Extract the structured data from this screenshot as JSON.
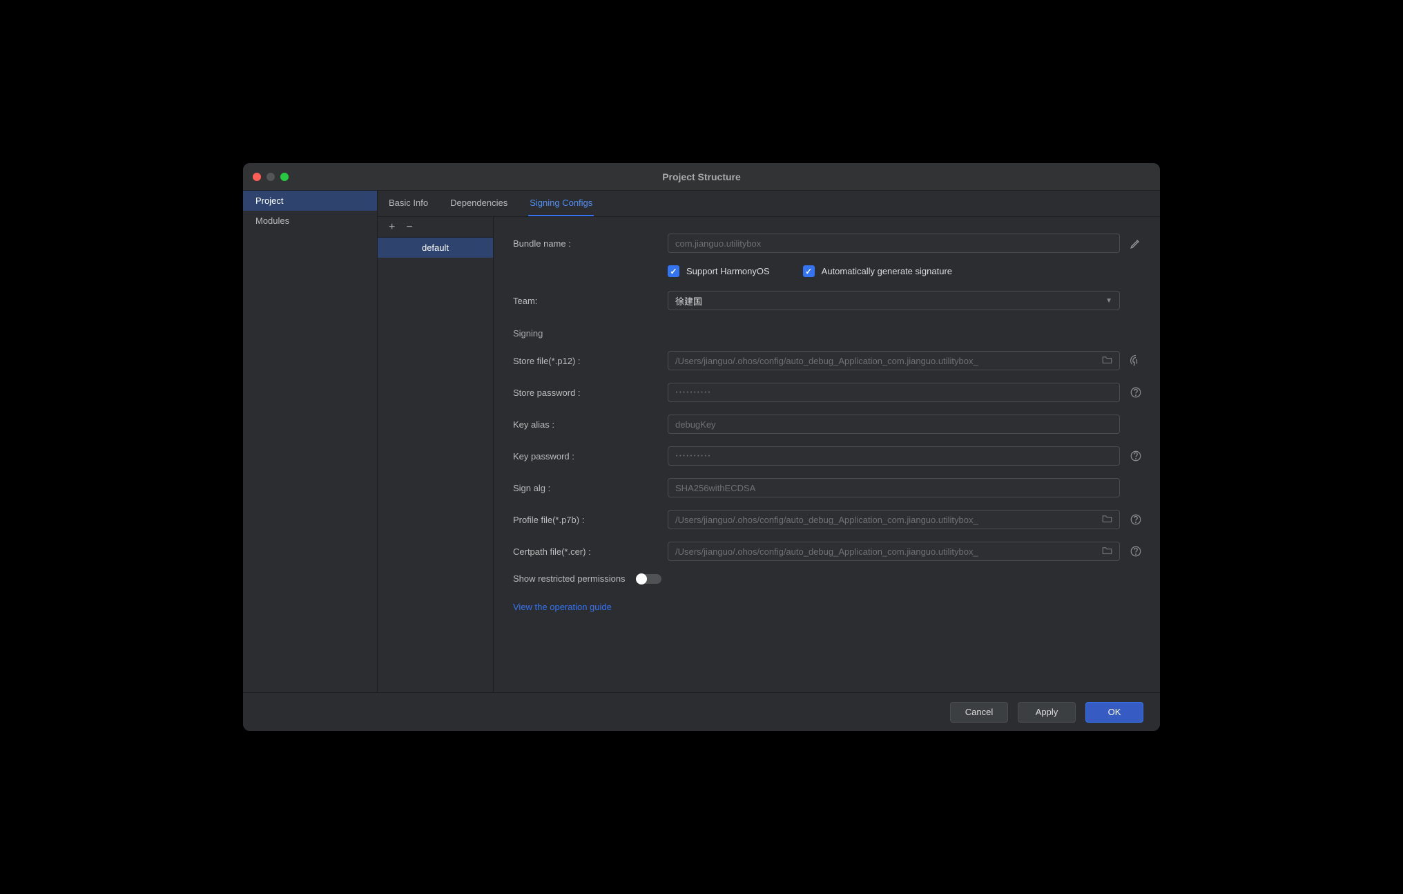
{
  "window": {
    "title": "Project Structure"
  },
  "sidebar": {
    "items": [
      {
        "label": "Project",
        "selected": true
      },
      {
        "label": "Modules",
        "selected": false
      }
    ]
  },
  "tabs": [
    {
      "label": "Basic Info",
      "active": false
    },
    {
      "label": "Dependencies",
      "active": false
    },
    {
      "label": "Signing Configs",
      "active": true
    }
  ],
  "configs": {
    "items": [
      {
        "label": "default",
        "selected": true
      }
    ]
  },
  "form": {
    "bundle_label": "Bundle name :",
    "bundle_value": "com.jianguo.utilitybox",
    "support_harmony_label": "Support HarmonyOS",
    "auto_sign_label": "Automatically generate signature",
    "team_label": "Team:",
    "team_value": "徐建国",
    "section_signing": "Signing",
    "store_file_label": "Store file(*.p12) :",
    "store_file_value": "/Users/jianguo/.ohos/config/auto_debug_Application_com.jianguo.utilitybox_",
    "store_password_label": "Store password :",
    "store_password_value": "••••••••••",
    "key_alias_label": "Key alias :",
    "key_alias_value": "debugKey",
    "key_password_label": "Key password :",
    "key_password_value": "••••••••••",
    "sign_alg_label": "Sign alg :",
    "sign_alg_value": "SHA256withECDSA",
    "profile_file_label": "Profile file(*.p7b) :",
    "profile_file_value": "/Users/jianguo/.ohos/config/auto_debug_Application_com.jianguo.utilitybox_",
    "certpath_label": "Certpath file(*.cer) :",
    "certpath_value": "/Users/jianguo/.ohos/config/auto_debug_Application_com.jianguo.utilitybox_",
    "show_restricted_label": "Show restricted permissions",
    "guide_link": "View the operation guide"
  },
  "footer": {
    "cancel": "Cancel",
    "apply": "Apply",
    "ok": "OK"
  }
}
